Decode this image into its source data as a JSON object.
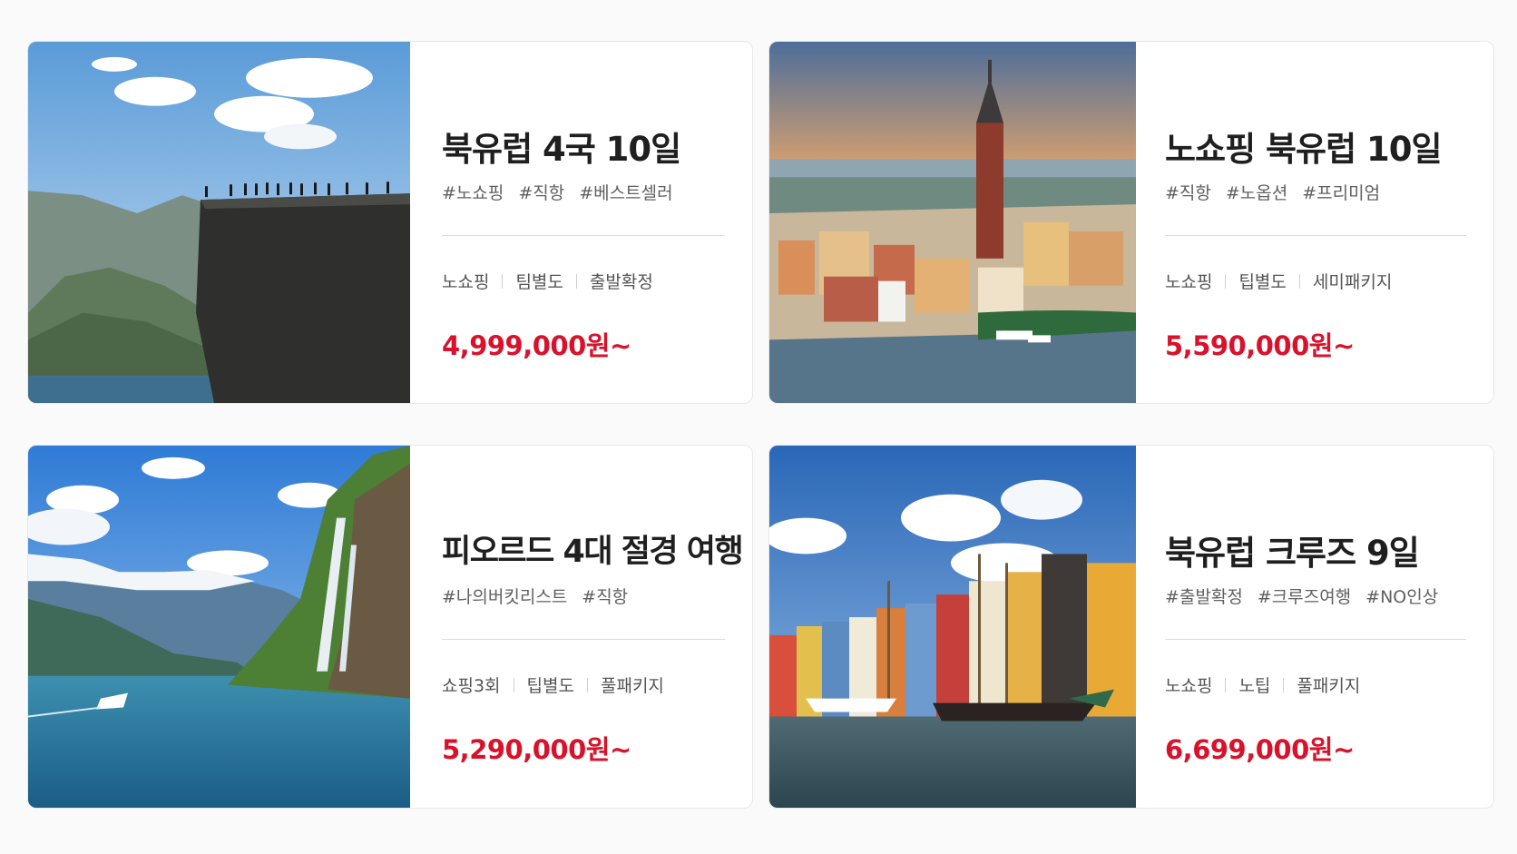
{
  "products": [
    {
      "title": "북유럽 4국 10일",
      "tags": [
        "#노쇼핑",
        "#직항",
        "#베스트셀러"
      ],
      "attributes": [
        "노쇼핑",
        "팀별도",
        "출발확정"
      ],
      "price": "4,999,000원~",
      "image": "preikestolen-cliff-fjord"
    },
    {
      "title": "노쇼핑 북유럽 10일",
      "tags": [
        "#직항",
        "#노옵션",
        "#프리미엄"
      ],
      "attributes": [
        "노쇼핑",
        "팁별도",
        "세미패키지"
      ],
      "price": "5,590,000원~",
      "image": "stockholm-old-town-sunset"
    },
    {
      "title": "피오르드 4대 절경 여행",
      "tags": [
        "#나의버킷리스트",
        "#직항"
      ],
      "attributes": [
        "쇼핑3회",
        "팁별도",
        "풀패키지"
      ],
      "price": "5,290,000원~",
      "image": "geiranger-fjord-waterfall"
    },
    {
      "title": "북유럽 크루즈 9일",
      "tags": [
        "#출발확정",
        "#크루즈여행",
        "#NO인상"
      ],
      "attributes": [
        "노쇼핑",
        "노팁",
        "풀패키지"
      ],
      "price": "6,699,000원~",
      "image": "nyhavn-harbor-copenhagen"
    }
  ],
  "colors": {
    "price": "#d9122b",
    "title": "#1f1f1f",
    "tag": "#606060",
    "border": "#e8e8e8"
  }
}
